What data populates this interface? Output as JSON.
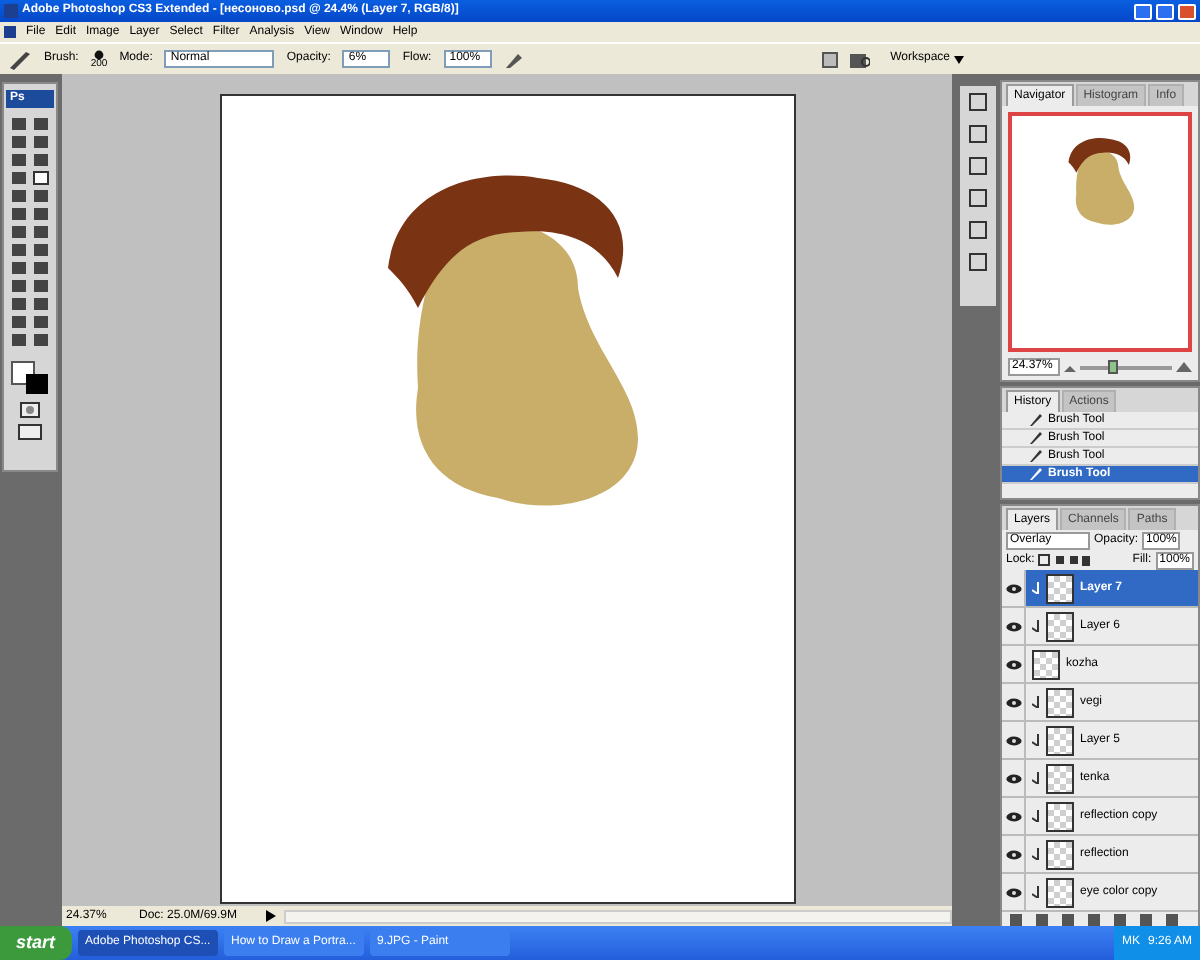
{
  "window": {
    "title": "Adobe Photoshop CS3 Extended - [несоново.psd @ 24.4% (Layer 7, RGB/8)]"
  },
  "menu": [
    "File",
    "Edit",
    "Image",
    "Layer",
    "Select",
    "Filter",
    "Analysis",
    "View",
    "Window",
    "Help"
  ],
  "options_bar": {
    "brush_label": "Brush:",
    "brush_size": "200",
    "mode_label": "Mode:",
    "mode": "Normal",
    "opacity_label": "Opacity:",
    "opacity": "6%",
    "flow_label": "Flow:",
    "flow": "100%",
    "workspace": "Workspace"
  },
  "toolbox": {
    "logo": "Ps"
  },
  "status_bar": {
    "zoom": "24.37%",
    "doc": "Doc: 25.0M/69.9M"
  },
  "navigator": {
    "tabs": [
      {
        "label": "Navigator",
        "selected": true
      },
      {
        "label": "Histogram",
        "selected": false
      },
      {
        "label": "Info",
        "selected": false
      }
    ],
    "zoom": "24.37%",
    "level": 0.35
  },
  "history": {
    "tabs": [
      {
        "label": "History",
        "selected": true
      },
      {
        "label": "Actions",
        "selected": false
      }
    ],
    "items": [
      {
        "label": "Brush Tool",
        "selected": false
      },
      {
        "label": "Brush Tool",
        "selected": false
      },
      {
        "label": "Brush Tool",
        "selected": false
      },
      {
        "label": "Brush Tool",
        "selected": true
      }
    ]
  },
  "layers": {
    "tabs": [
      {
        "label": "Layers",
        "selected": true
      },
      {
        "label": "Channels",
        "selected": false
      },
      {
        "label": "Paths",
        "selected": false
      }
    ],
    "blend_mode": "Overlay",
    "opacity_label": "Opacity:",
    "opacity": "100%",
    "lock_label": "Lock:",
    "fill_label": "Fill:",
    "fill": "100%",
    "items": [
      {
        "name": "Layer 7",
        "selected": true,
        "clipped": true
      },
      {
        "name": "Layer 6",
        "selected": false,
        "clipped": true
      },
      {
        "name": "kozha",
        "selected": false,
        "clipped": false
      },
      {
        "name": "vegi",
        "selected": false,
        "clipped": true
      },
      {
        "name": "Layer 5",
        "selected": false,
        "clipped": true
      },
      {
        "name": "tenka",
        "selected": false,
        "clipped": true
      },
      {
        "name": "reflection copy",
        "selected": false,
        "clipped": true
      },
      {
        "name": "reflection",
        "selected": false,
        "clipped": true
      },
      {
        "name": "eye color copy",
        "selected": false,
        "clipped": true
      }
    ]
  },
  "taskbar": {
    "start": "start",
    "tasks": [
      {
        "label": "Adobe Photoshop CS...",
        "selected": true
      },
      {
        "label": "How to Draw a Portra...",
        "selected": false
      },
      {
        "label": "9.JPG - Paint",
        "selected": false
      }
    ],
    "language": "MK",
    "time": "9:26 AM"
  }
}
